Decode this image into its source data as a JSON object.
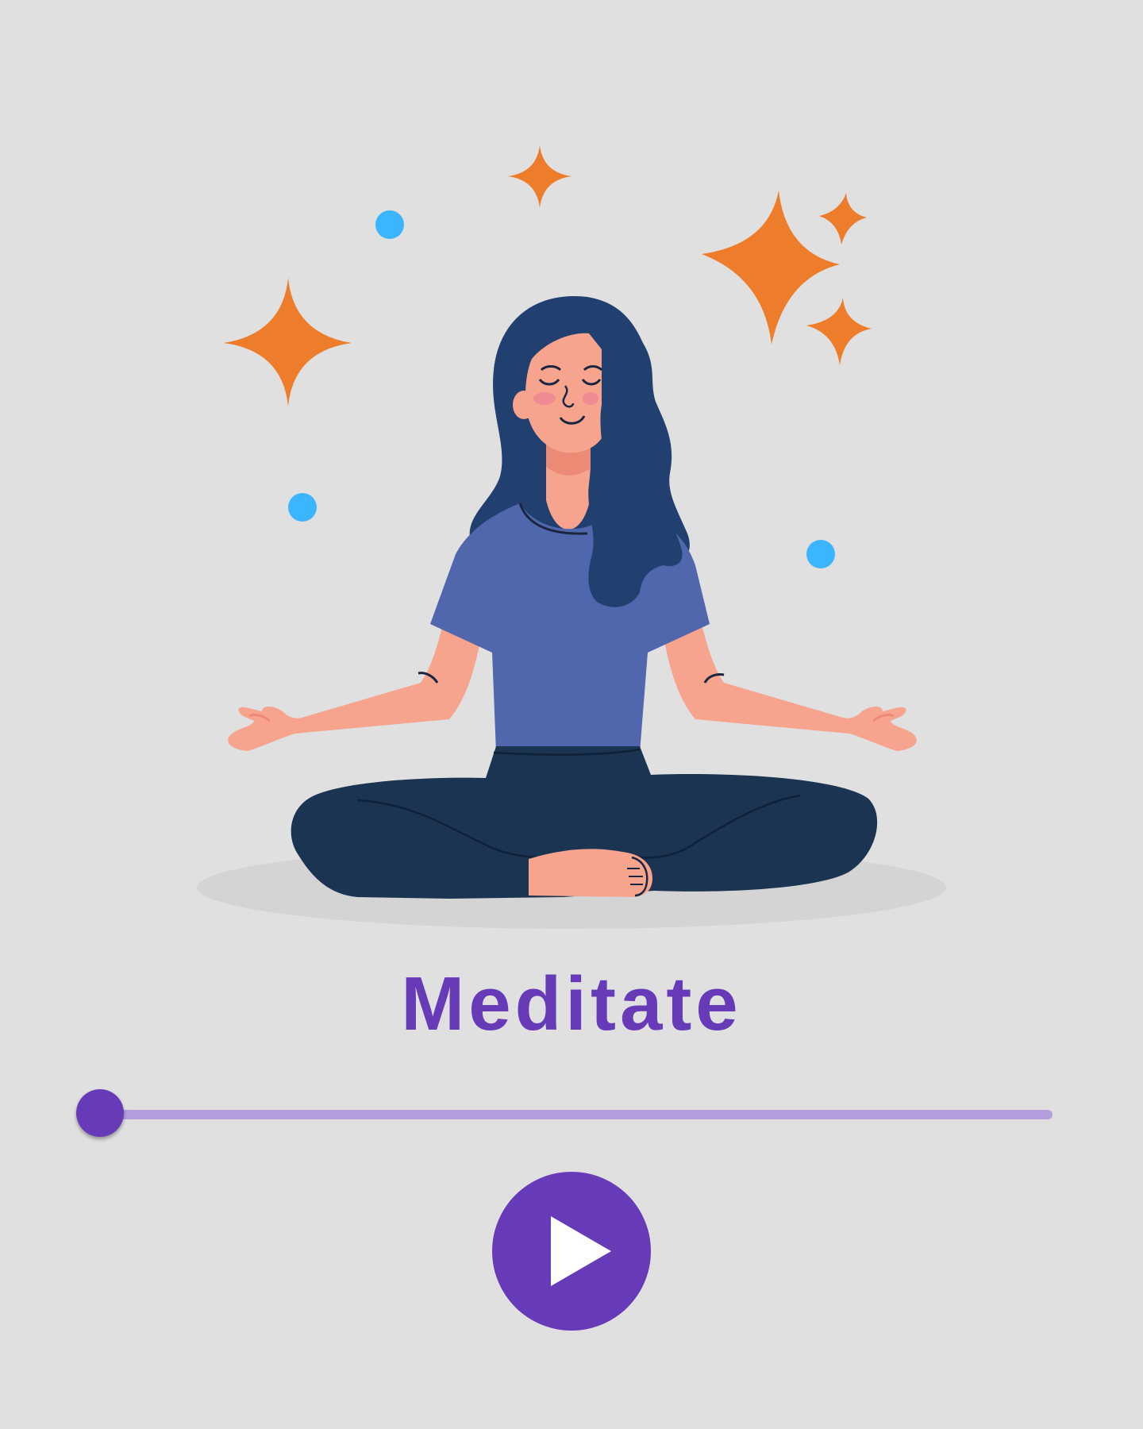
{
  "screen": {
    "title": "Meditate"
  },
  "player": {
    "progress": 0,
    "play_icon": "play-icon"
  },
  "illustration": {
    "subject": "meditating-woman-illustration"
  },
  "colors": {
    "background": "#e0e0e0",
    "accent": "#673ab7",
    "track": "#b39ddb",
    "sparkle": "#ee7d2b",
    "dot": "#3cb5ff",
    "hair": "#21406f",
    "shirt": "#5067ad",
    "pants": "#1a3452",
    "skin": "#f7a48e"
  }
}
